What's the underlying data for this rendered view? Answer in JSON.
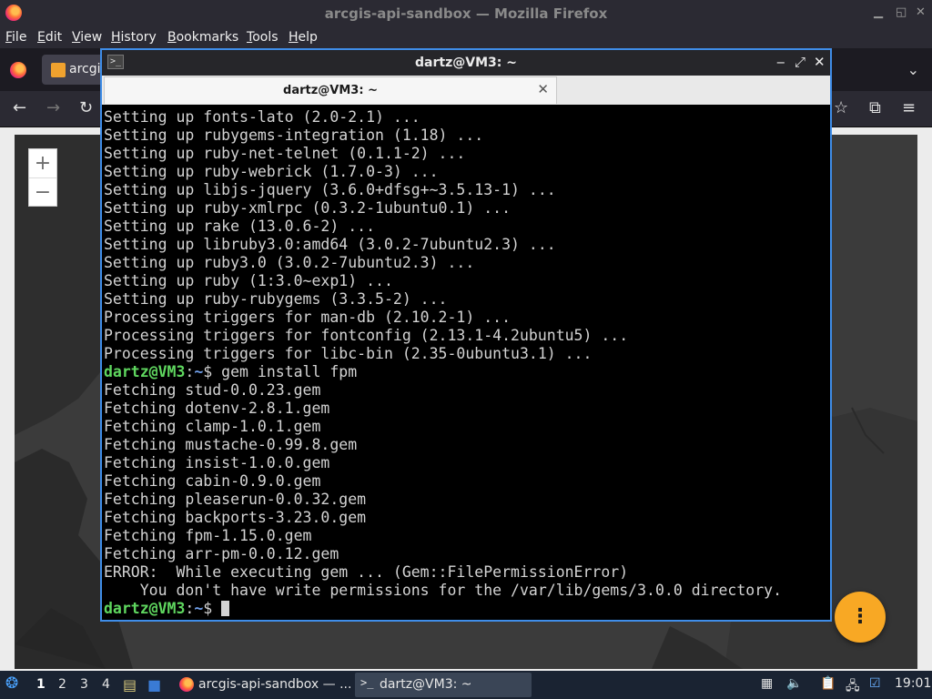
{
  "firefox": {
    "title": "arcgis-api-sandbox — Mozilla Firefox",
    "menu": [
      "File",
      "Edit",
      "View",
      "History",
      "Bookmarks",
      "Tools",
      "Help"
    ],
    "menu_accel": [
      "F",
      "E",
      "V",
      "H",
      "B",
      "T",
      "H"
    ],
    "menu_rest": [
      "ile",
      "dit",
      "iew",
      "istory",
      "ookmarks",
      "ools",
      "elp"
    ],
    "tab_label": "arcgi",
    "fab_label": "⋮"
  },
  "map": {
    "zoom_in": "+",
    "zoom_out": "−"
  },
  "terminal": {
    "title": "dartz@VM3: ~",
    "tab_label": "dartz@VM3: ~",
    "lines": [
      {
        "text": "Setting up fonts-lato (2.0-2.1) ..."
      },
      {
        "text": "Setting up rubygems-integration (1.18) ..."
      },
      {
        "text": "Setting up ruby-net-telnet (0.1.1-2) ..."
      },
      {
        "text": "Setting up ruby-webrick (1.7.0-3) ..."
      },
      {
        "text": "Setting up libjs-jquery (3.6.0+dfsg+~3.5.13-1) ..."
      },
      {
        "text": "Setting up ruby-xmlrpc (0.3.2-1ubuntu0.1) ..."
      },
      {
        "text": "Setting up rake (13.0.6-2) ..."
      },
      {
        "text": "Setting up libruby3.0:amd64 (3.0.2-7ubuntu2.3) ..."
      },
      {
        "text": "Setting up ruby3.0 (3.0.2-7ubuntu2.3) ..."
      },
      {
        "text": "Setting up ruby (1:3.0~exp1) ..."
      },
      {
        "text": "Setting up ruby-rubygems (3.3.5-2) ..."
      },
      {
        "text": "Processing triggers for man-db (2.10.2-1) ..."
      },
      {
        "text": "Processing triggers for fontconfig (2.13.1-4.2ubuntu5) ..."
      },
      {
        "text": "Processing triggers for libc-bin (2.35-0ubuntu3.1) ..."
      },
      {
        "prompt_user": "dartz@VM3",
        "prompt_sep": ":",
        "prompt_path": "~",
        "prompt_sym": "$ ",
        "cmd": "gem install fpm"
      },
      {
        "text": "Fetching stud-0.0.23.gem"
      },
      {
        "text": "Fetching dotenv-2.8.1.gem"
      },
      {
        "text": "Fetching clamp-1.0.1.gem"
      },
      {
        "text": "Fetching mustache-0.99.8.gem"
      },
      {
        "text": "Fetching insist-1.0.0.gem"
      },
      {
        "text": "Fetching cabin-0.9.0.gem"
      },
      {
        "text": "Fetching pleaserun-0.0.32.gem"
      },
      {
        "text": "Fetching backports-3.23.0.gem"
      },
      {
        "text": "Fetching fpm-1.15.0.gem"
      },
      {
        "text": "Fetching arr-pm-0.0.12.gem"
      },
      {
        "text": "ERROR:  While executing gem ... (Gem::FilePermissionError)"
      },
      {
        "text": "    You don't have write permissions for the /var/lib/gems/3.0.0 directory."
      },
      {
        "prompt_user": "dartz@VM3",
        "prompt_sep": ":",
        "prompt_path": "~",
        "prompt_sym": "$ ",
        "cmd": "",
        "cursor": true
      }
    ]
  },
  "taskbar": {
    "workspaces": [
      "1",
      "2",
      "3",
      "4"
    ],
    "active_workspace": "1",
    "tasks": [
      {
        "label": "arcgis-api-sandbox — ...",
        "icon": "firefox-icon"
      },
      {
        "label": "dartz@VM3: ~",
        "icon": "terminal-icon"
      }
    ],
    "clock": "19:01"
  },
  "colors": {
    "accent_border": "#3f8de8",
    "prompt_user": "#5fd75f",
    "prompt_path": "#6f9ee8",
    "fab": "#f8a824"
  }
}
